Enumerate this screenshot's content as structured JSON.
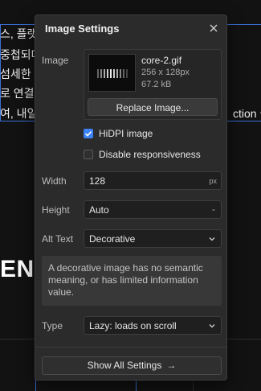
{
  "background": {
    "line1": "스, 플랫",
    "line2": "중첩되며",
    "line3": "섬세한",
    "line4": "로 연결하",
    "line5": "여, 내일",
    "line5_right": "ction 을",
    "big_text": "ENC"
  },
  "panel": {
    "title": "Image Settings",
    "image_label": "Image",
    "file_name": "core-2.gif",
    "file_dims": "256 x 128px",
    "file_size": "67.2 kB",
    "replace_label": "Replace Image...",
    "hidpi_label": "HiDPI image",
    "hidpi_checked": true,
    "disable_resp_label": "Disable responsiveness",
    "disable_resp_checked": false,
    "width_label": "Width",
    "width_value": "128",
    "width_unit": "px",
    "height_label": "Height",
    "height_value": "Auto",
    "height_unit": "-",
    "alt_label": "Alt Text",
    "alt_value": "Decorative",
    "info_text": "A decorative image has no semantic meaning, or has limited information value.",
    "type_label": "Type",
    "type_value": "Lazy: loads on scroll",
    "show_all_label": "Show All Settings",
    "show_all_arrow": "→"
  },
  "colors": {
    "accent": "#3b82f6",
    "selection": "#3b6fd6",
    "panel_bg": "#2b2b2b"
  }
}
